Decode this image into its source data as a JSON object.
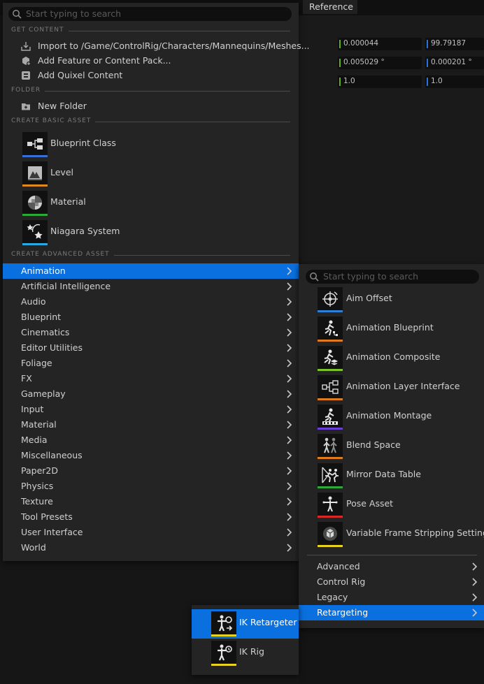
{
  "background": {
    "tab_label": "Reference",
    "rows": [
      {
        "values": [
          "0.000044",
          "99.79187"
        ]
      },
      {
        "values": [
          "0.005029 °",
          "0.000201 °"
        ]
      },
      {
        "values": [
          "1.0",
          "1.0"
        ]
      }
    ]
  },
  "main_menu": {
    "search_placeholder": "Start typing to search",
    "sections": {
      "get_content": "GET CONTENT",
      "folder": "FOLDER",
      "basic_asset": "CREATE BASIC ASSET",
      "advanced_asset": "CREATE ADVANCED ASSET"
    },
    "get_content_items": [
      {
        "label": "Import to /Game/ControlRig/Characters/Mannequins/Meshes...",
        "icon": "import-icon"
      },
      {
        "label": "Add Feature or Content Pack...",
        "icon": "content-pack-icon"
      },
      {
        "label": "Add Quixel Content",
        "icon": "quixel-icon"
      }
    ],
    "folder_item": {
      "label": "New Folder",
      "icon": "folder-add-icon"
    },
    "basic_assets": [
      {
        "label": "Blueprint Class",
        "icon": "blueprint-class-icon",
        "color": "#3b6fd8"
      },
      {
        "label": "Level",
        "icon": "level-icon",
        "color": "#e08a1e"
      },
      {
        "label": "Material",
        "icon": "material-icon",
        "color": "#2fa83a"
      },
      {
        "label": "Niagara System",
        "icon": "niagara-icon",
        "color": "#27a9e1"
      }
    ],
    "categories": [
      "Animation",
      "Artificial Intelligence",
      "Audio",
      "Blueprint",
      "Cinematics",
      "Editor Utilities",
      "Foliage",
      "FX",
      "Gameplay",
      "Input",
      "Material",
      "Media",
      "Miscellaneous",
      "Paper2D",
      "Physics",
      "Texture",
      "Tool Presets",
      "User Interface",
      "World"
    ],
    "selected_category": "Animation"
  },
  "animation_menu": {
    "search_placeholder": "Start typing to search",
    "assets": [
      {
        "label": "Aim Offset",
        "icon": "aim-offset-icon",
        "color": "#2c7fd6"
      },
      {
        "label": "Animation Blueprint",
        "icon": "animation-blueprint-icon",
        "color": "#e07a1e"
      },
      {
        "label": "Animation Composite",
        "icon": "animation-composite-icon",
        "color": "#7bc22a"
      },
      {
        "label": "Animation Layer Interface",
        "icon": "animation-layer-interface-icon",
        "color": "#e07a1e"
      },
      {
        "label": "Animation Montage",
        "icon": "animation-montage-icon",
        "color": "#6a3fd8"
      },
      {
        "label": "Blend Space",
        "icon": "blend-space-icon",
        "color": "#e07a1e"
      },
      {
        "label": "Mirror Data Table",
        "icon": "mirror-data-table-icon",
        "color": "#2fa83a"
      },
      {
        "label": "Pose Asset",
        "icon": "pose-asset-icon",
        "color": "#d62a2a"
      },
      {
        "label": "Variable Frame Stripping Settings",
        "icon": "frame-stripping-icon",
        "color": "#e8d21e"
      }
    ],
    "subcategories": [
      "Advanced",
      "Control Rig",
      "Legacy",
      "Retargeting"
    ],
    "selected_subcategory": "Retargeting"
  },
  "retargeting_menu": {
    "assets": [
      {
        "label": "IK Retargeter",
        "icon": "ik-retargeter-icon",
        "color": "#e8d21e",
        "selected": true
      },
      {
        "label": "IK Rig",
        "icon": "ik-rig-icon",
        "color": "#e8d21e",
        "selected": false
      }
    ]
  },
  "colors": {
    "selection": "#0a70e0",
    "menu_background": "#242424"
  }
}
